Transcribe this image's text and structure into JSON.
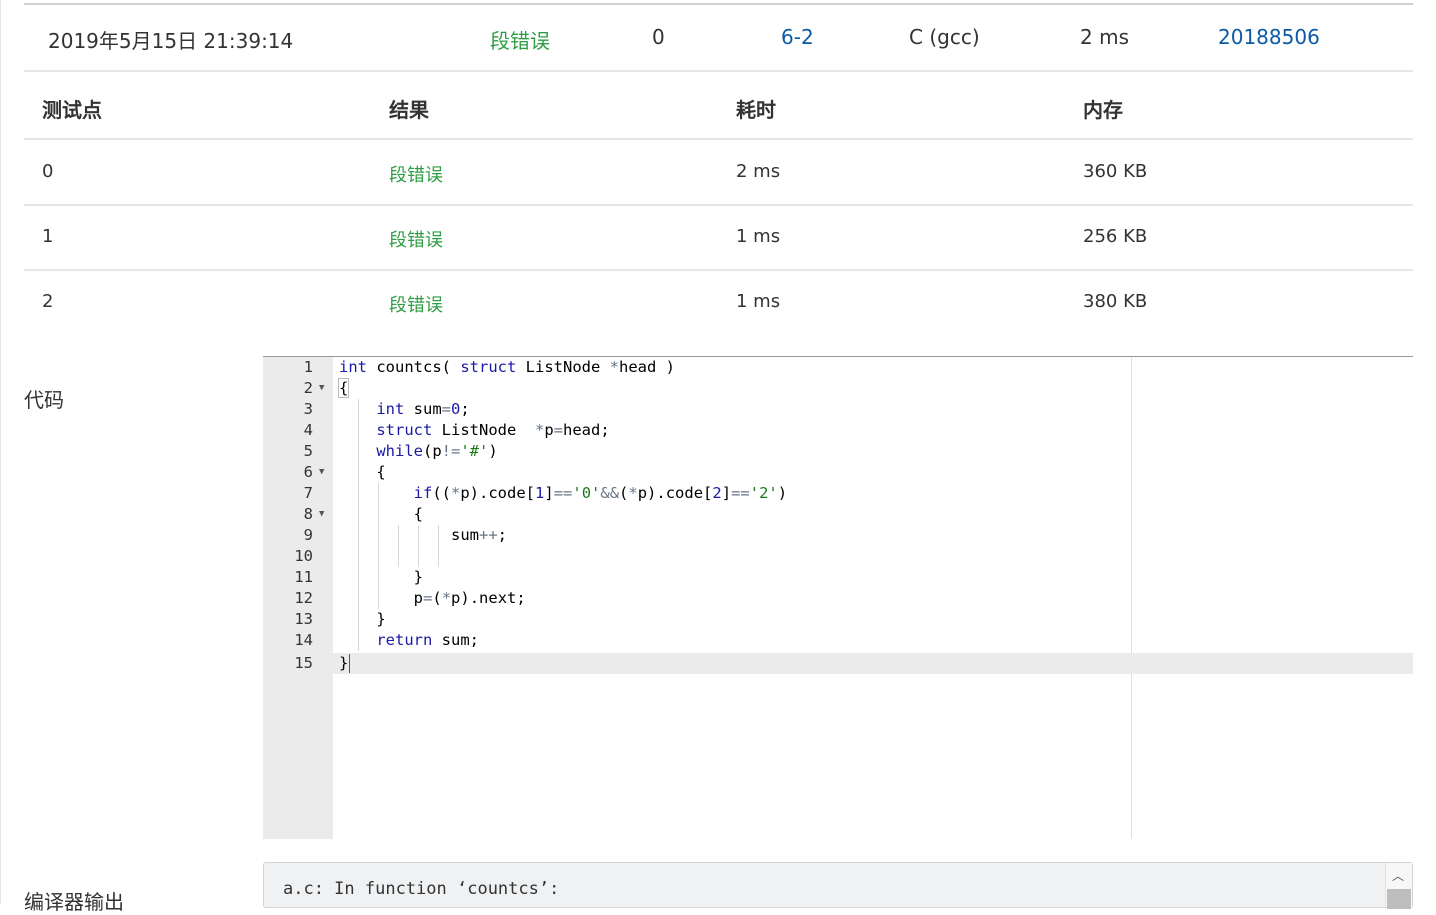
{
  "submission": {
    "time": "2019年5月15日 21:39:14",
    "status": "段错误",
    "score": "0",
    "problem": "6-2",
    "compiler": "C (gcc)",
    "duration": "2 ms",
    "user": "20188506"
  },
  "tests": {
    "headers": [
      "测试点",
      "结果",
      "耗时",
      "内存"
    ],
    "rows": [
      {
        "id": "0",
        "result": "段错误",
        "time": "2 ms",
        "memory": "360 KB"
      },
      {
        "id": "1",
        "result": "段错误",
        "time": "1 ms",
        "memory": "256 KB"
      },
      {
        "id": "2",
        "result": "段错误",
        "time": "1 ms",
        "memory": "380 KB"
      }
    ]
  },
  "code_section": {
    "label": "代码",
    "line_numbers": [
      "1",
      "2",
      "3",
      "4",
      "5",
      "6",
      "7",
      "8",
      "9",
      "10",
      "11",
      "12",
      "13",
      "14",
      "15"
    ],
    "lines": [
      "int countcs( struct ListNode *head )",
      "{",
      "    int sum=0;",
      "    struct ListNode  *p=head;",
      "    while(p!='#')",
      "    {",
      "        if((*p).code[1]=='0'&&(*p).code[2]=='2')",
      "        {",
      "            sum++;",
      "",
      "        }",
      "        p=(*p).next;",
      "    }",
      "    return sum;",
      "}"
    ],
    "active_line": "15"
  },
  "compiler_output": {
    "label": "编译器输出",
    "text": "a.c: In function ‘countcs’:"
  },
  "colors": {
    "status_error": "#2e9e44",
    "link": "#0a5aa6",
    "keyword": "#1a1aa6",
    "string": "#1a7a1a"
  }
}
